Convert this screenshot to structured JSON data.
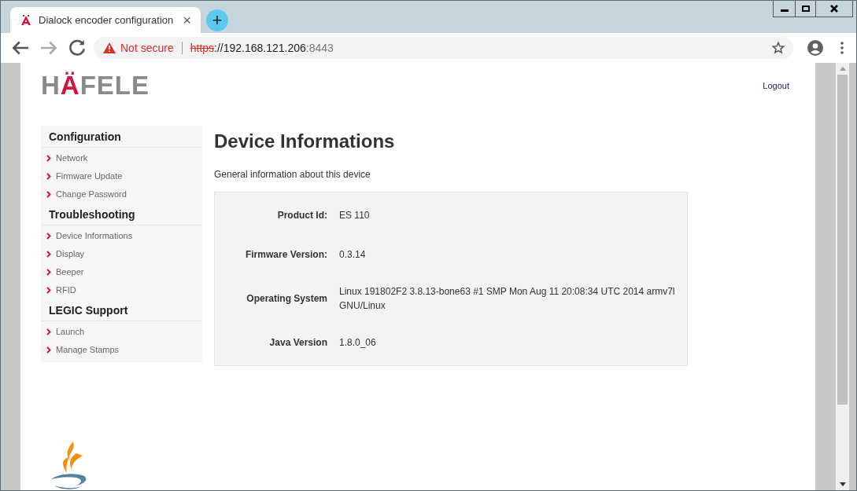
{
  "browser": {
    "tab": {
      "title": "Dialock encoder configuration",
      "close": "×",
      "new_tab": "+"
    },
    "address_bar": {
      "security": "Not secure",
      "scheme": "https",
      "rest": "://192.168.121.206",
      "port": ":8443"
    }
  },
  "header": {
    "logo_parts": [
      {
        "text": "H",
        "accent": false
      },
      {
        "text": "Ä",
        "accent": true
      },
      {
        "text": "FELE",
        "accent": false
      }
    ],
    "logout": "Logout"
  },
  "sidebar": {
    "sections": [
      {
        "title": "Configuration",
        "items": [
          "Network",
          "Firmware Update",
          "Change Password"
        ]
      },
      {
        "title": "Troubleshooting",
        "items": [
          "Device Informations",
          "Display",
          "Beeper",
          "RFID"
        ]
      },
      {
        "title": "LEGIC Support",
        "items": [
          "Launch",
          "Manage Stamps"
        ]
      }
    ]
  },
  "main": {
    "title": "Device Informations",
    "subtitle": "General information about this device",
    "fields": [
      {
        "label": "Product Id:",
        "value": "ES 110"
      },
      {
        "label": "Firmware Version:",
        "value": "0.3.14"
      },
      {
        "label": "Operating System",
        "value": "Linux 191802F2 3.8.13-bone63 #1 SMP Mon Aug 11 20:08:34 UTC 2014 armv7l GNU/Linux"
      },
      {
        "label": "Java Version",
        "value": "1.8.0_06"
      }
    ]
  }
}
